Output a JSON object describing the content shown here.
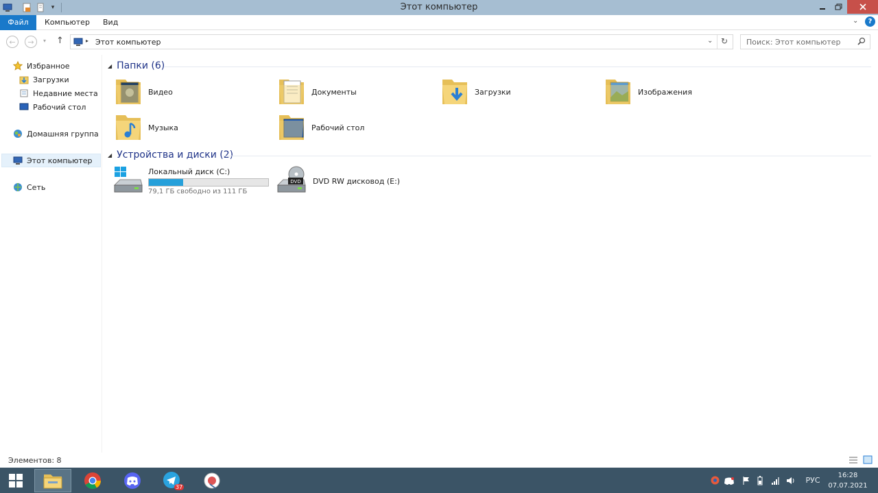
{
  "window": {
    "title": "Этот компьютер"
  },
  "ribbon": {
    "tabs": [
      "Файл",
      "Компьютер",
      "Вид"
    ]
  },
  "address": {
    "path": "Этот компьютер",
    "search_placeholder": "Поиск: Этот компьютер"
  },
  "sidebar": {
    "favorites": "Избранное",
    "favorites_items": [
      "Загрузки",
      "Недавние места",
      "Рабочий стол"
    ],
    "homegroup": "Домашняя группа",
    "this_pc": "Этот компьютер",
    "network": "Сеть"
  },
  "folders_section": {
    "title": "Папки (6)",
    "items": [
      "Видео",
      "Документы",
      "Загрузки",
      "Изображения",
      "Музыка",
      "Рабочий стол"
    ]
  },
  "devices_section": {
    "title": "Устройства и диски (2)"
  },
  "drive_c": {
    "name": "Локальный диск (C:)",
    "free_text": "79,1 ГБ свободно из 111 ГБ",
    "used_fraction": 0.29
  },
  "drive_e": {
    "name": "DVD RW дисковод (E:)",
    "badge": "DVD"
  },
  "status": {
    "items_count": "Элементов: 8"
  },
  "taskbar": {
    "lang": "РУС",
    "time": "16:28",
    "date": "07.07.2021",
    "telegram_badge": "37"
  },
  "colors": {
    "accent": "#1979ca",
    "titlebar": "#a6bed2",
    "taskbar": "#3b5466",
    "close": "#c7504a",
    "drive_fill": "#26a0da",
    "section_title": "#1e3287"
  }
}
